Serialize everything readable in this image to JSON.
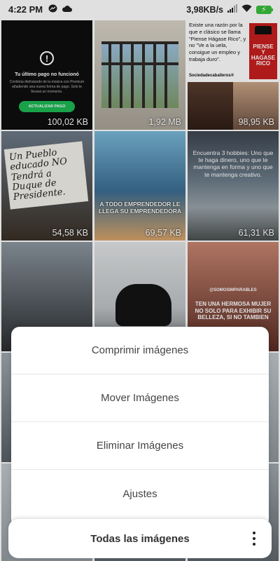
{
  "status_bar": {
    "time": "4:22 PM",
    "network_speed": "3,98KB/s",
    "left_icons": [
      "messenger-icon",
      "cloud-icon"
    ],
    "right_icons": [
      "signal-icon",
      "wifi-icon",
      "battery-charging-icon"
    ]
  },
  "images": [
    {
      "size": "100,02 KB",
      "kind": "spotify-screenshot",
      "heading": "Tu último pago no funcionó",
      "body": "Continúa disfrutando de la música con Premium añadiendo una nueva forma de pago. Solo te llevará un momento.",
      "button": "ACTUALIZAR PAGO"
    },
    {
      "size": "1,92 MB",
      "kind": "window-bars-photo"
    },
    {
      "size": "98,95 KB",
      "kind": "book-quote",
      "quote": "Existe una razón por la que e clásico se llama \"Piense Hágase Rico\", y no \"Ve a la uela, consigue un empleo y trabaja duro\".",
      "source": "Sociedadecaballeros®",
      "cover_title": "PIENSE Y HAGASE RICO"
    },
    {
      "size": "54,58 KB",
      "kind": "protest-sign",
      "sign_text": "Un Pueblo educado NO Tendrá a Duque de Presidente."
    },
    {
      "size": "69,57 KB",
      "kind": "beach-quote",
      "caption": "A TODO EMPRENDEDOR LE LLEGA SU EMPRENDEDORA"
    },
    {
      "size": "61,31 KB",
      "kind": "sea-quote",
      "quote": "Encuentra 3 hobbies: Uno que te haga dinero, uno que te mantenga en forma y uno que te mantenga creativo."
    },
    {
      "size": "",
      "kind": "hand-phone-photo"
    },
    {
      "size": "",
      "kind": "motorcycle-photo"
    },
    {
      "size": "",
      "kind": "couple-quote",
      "handle": "@SOMOSIMPARABLES",
      "caption": "TEN UNA HERMOSA MUJER NO SOLO PARA EXHIBIR SU BELLEZA, SI NO TAMBIEN"
    }
  ],
  "action_sheet": {
    "options": [
      "Comprimir imágenes",
      "Mover Imágenes",
      "Eliminar Imágenes",
      "Ajustes"
    ]
  },
  "bottom_bar": {
    "title": "Todas las imágenes",
    "menu_icon": "more-vertical-icon"
  }
}
